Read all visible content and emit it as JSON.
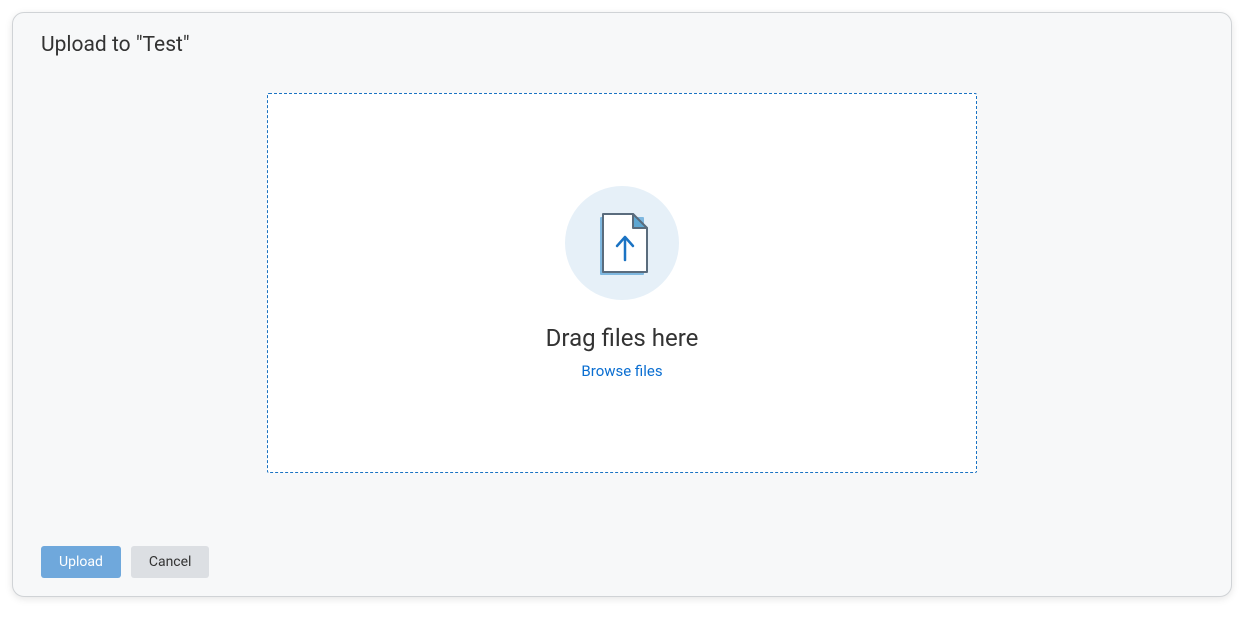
{
  "dialog": {
    "title": "Upload to \"Test\""
  },
  "dropzone": {
    "heading": "Drag files here",
    "browse_label": "Browse files"
  },
  "footer": {
    "upload_label": "Upload",
    "cancel_label": "Cancel"
  }
}
